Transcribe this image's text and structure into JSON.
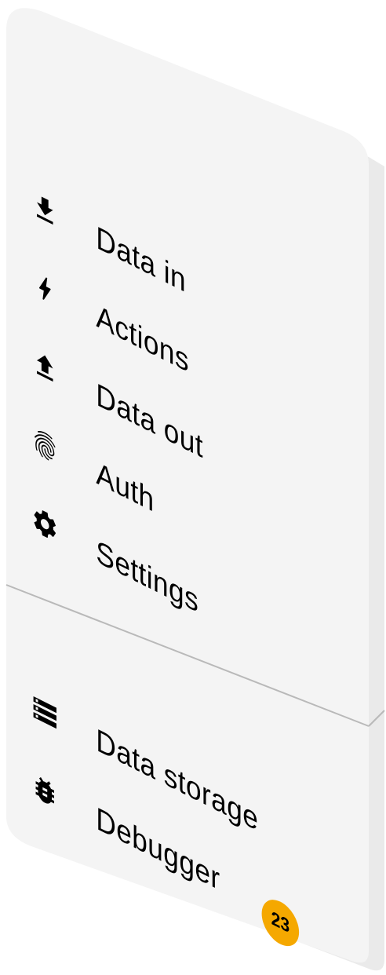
{
  "menu": {
    "items": [
      {
        "label": "Data in",
        "icon": "download-icon"
      },
      {
        "label": "Actions",
        "icon": "bolt-icon"
      },
      {
        "label": "Data out",
        "icon": "upload-icon"
      },
      {
        "label": "Auth",
        "icon": "fingerprint-icon"
      },
      {
        "label": "Settings",
        "icon": "gear-icon"
      }
    ],
    "secondary": [
      {
        "label": "Data storage",
        "icon": "data-storage-icon"
      },
      {
        "label": "Debugger",
        "icon": "bug-icon",
        "badge": "23"
      }
    ]
  },
  "colors": {
    "panel": "#f4f4f4",
    "panel_side": "#e9e9e9",
    "divider": "#b9b9b9",
    "badge": "#f5a800",
    "text": "#000000"
  }
}
